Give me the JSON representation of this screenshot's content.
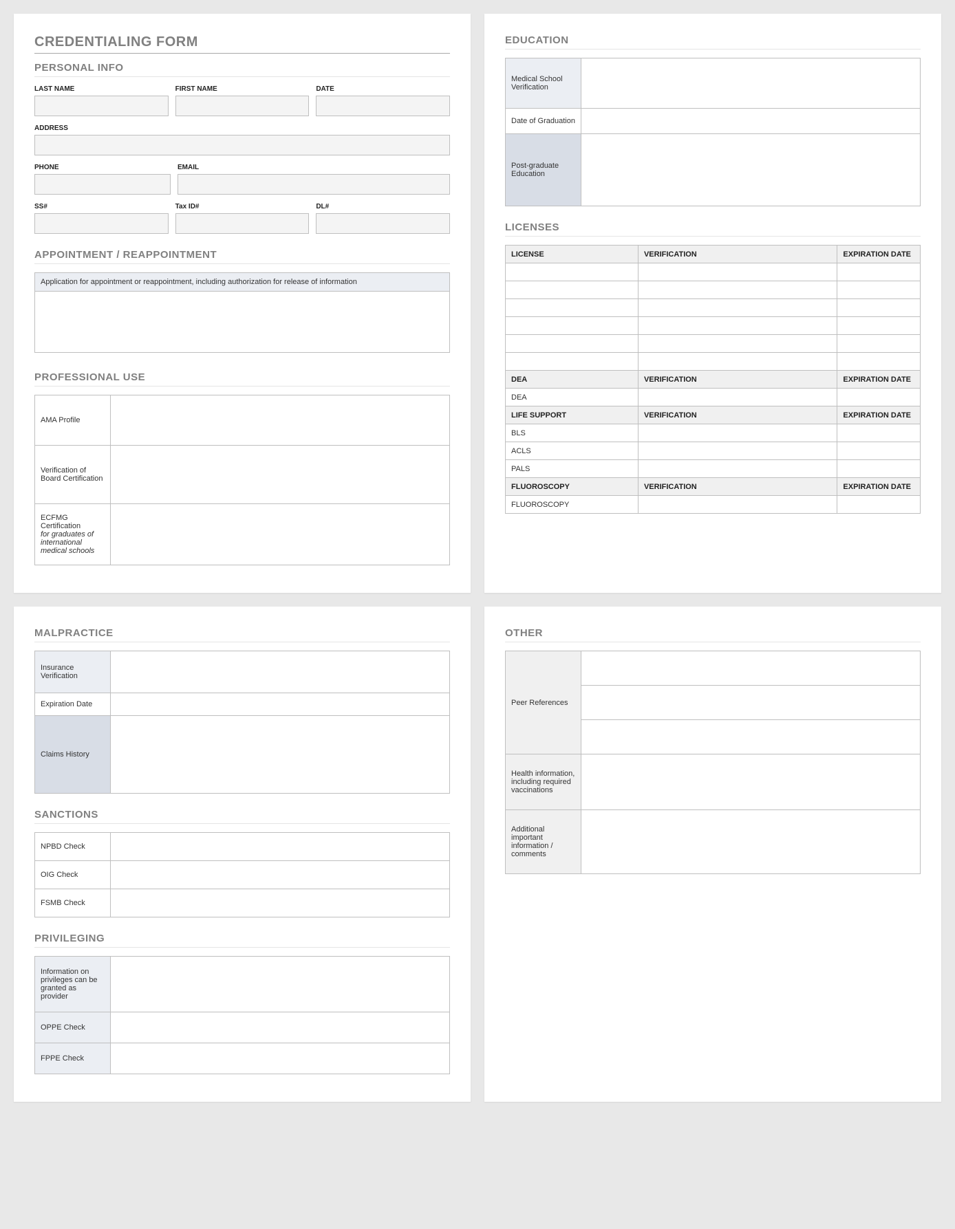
{
  "form_title": "CREDENTIALING FORM",
  "panel1": {
    "personal": {
      "head": "PERSONAL INFO",
      "last_name_label": "LAST NAME",
      "first_name_label": "FIRST NAME",
      "date_label": "DATE",
      "address_label": "ADDRESS",
      "phone_label": "PHONE",
      "email_label": "EMAIL",
      "ss_label": "SS#",
      "tax_label": "Tax ID#",
      "dl_label": "DL#"
    },
    "appoint": {
      "head": "APPOINTMENT / REAPPOINTMENT",
      "note": "Application for appointment or reappointment, including authorization for release of information"
    },
    "prof": {
      "head": "PROFESSIONAL USE",
      "rows": {
        "ama": "AMA Profile",
        "board": "Verification of Board Certification",
        "ecfmg_a": "ECFMG Certification",
        "ecfmg_b": "for graduates of international medical schools"
      }
    }
  },
  "panel2": {
    "edu": {
      "head": "EDUCATION",
      "medschool": "Medical School Verification",
      "grad": "Date of Graduation",
      "postgrad": "Post-graduate Education"
    },
    "lic": {
      "head": "LICENSES",
      "h_license": "LICENSE",
      "h_ver": "VERIFICATION",
      "h_exp": "EXPIRATION DATE",
      "h_dea": "DEA",
      "r_dea": "DEA",
      "h_life": "LIFE SUPPORT",
      "r_bls": "BLS",
      "r_acls": "ACLS",
      "r_pals": "PALS",
      "h_fluoro": "FLUOROSCOPY",
      "r_fluoro": "FLUOROSCOPY"
    }
  },
  "panel3": {
    "mal": {
      "head": "MALPRACTICE",
      "ins": "Insurance Verification",
      "exp": "Expiration Date",
      "claims": "Claims History"
    },
    "sanc": {
      "head": "SANCTIONS",
      "npbd": "NPBD Check",
      "oig": "OIG Check",
      "fsmb": "FSMB Check"
    },
    "priv": {
      "head": "PRIVILEGING",
      "info": "Information on privileges can be granted as provider",
      "oppe": "OPPE Check",
      "fppe": "FPPE Check"
    }
  },
  "panel4": {
    "other": {
      "head": "OTHER",
      "peer": "Peer References",
      "health": "Health information, including required vaccinations",
      "addl": "Additional important information / comments"
    }
  }
}
